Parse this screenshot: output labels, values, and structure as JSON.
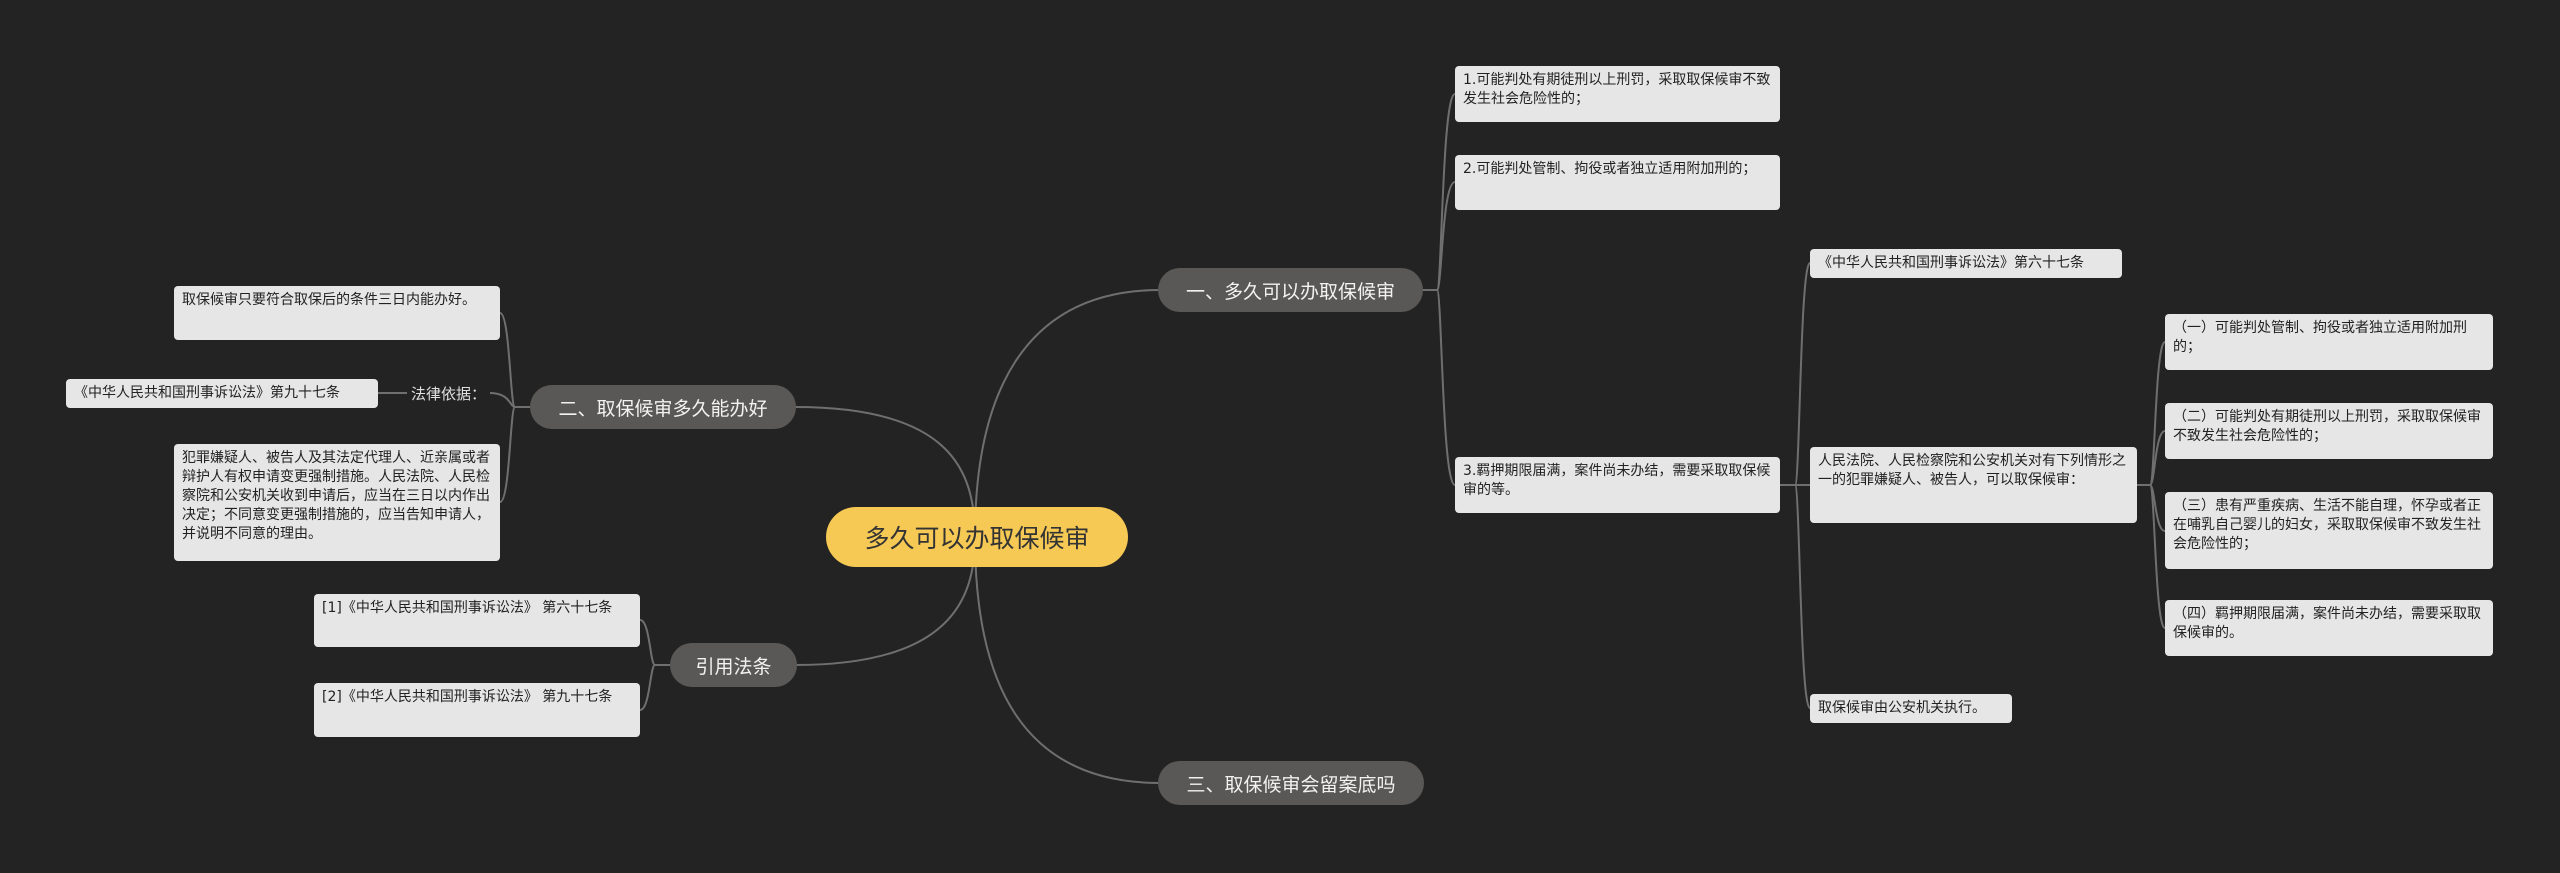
{
  "root": "多久可以办取保候审",
  "branches": {
    "b1": "一、多久可以办取保候审",
    "b2": "二、取保候审多久能办好",
    "b3": "三、取保候审会留案底吗",
    "b4": "引用法条"
  },
  "b1_children": {
    "c1": "1.可能判处有期徒刑以上刑罚，采取取保候审不致发生社会危险性的；",
    "c2": "2.可能判处管制、拘役或者独立适用附加刑的；",
    "c3": "3.羁押期限届满，案件尚未办结，需要采取取保候审的等。"
  },
  "c3_children": {
    "d1": "《中华人民共和国刑事诉讼法》第六十七条",
    "d2": "人民法院、人民检察院和公安机关对有下列情形之一的犯罪嫌疑人、被告人，可以取保候审：",
    "d3": "取保候审由公安机关执行。"
  },
  "d2_children": {
    "e1": "（一）可能判处管制、拘役或者独立适用附加刑的；",
    "e2": "（二）可能判处有期徒刑以上刑罚，采取取保候审不致发生社会危险性的；",
    "e3": "（三）患有严重疾病、生活不能自理，怀孕或者正在哺乳自己婴儿的妇女，采取取保候审不致发生社会危险性的；",
    "e4": "（四）羁押期限届满，案件尚未办结，需要采取取保候审的。"
  },
  "b2_children": {
    "f1": "取保候审只要符合取保后的条件三日内能办好。",
    "f2": "法律依据：",
    "f2_child": "《中华人民共和国刑事诉讼法》第九十七条",
    "f3": "犯罪嫌疑人、被告人及其法定代理人、近亲属或者辩护人有权申请变更强制措施。人民法院、人民检察院和公安机关收到申请后，应当在三日以内作出决定；不同意变更强制措施的，应当告知申请人，并说明不同意的理由。"
  },
  "b4_children": {
    "g1": "[1]《中华人民共和国刑事诉讼法》 第六十七条",
    "g2": "[2]《中华人民共和国刑事诉讼法》 第九十七条"
  }
}
